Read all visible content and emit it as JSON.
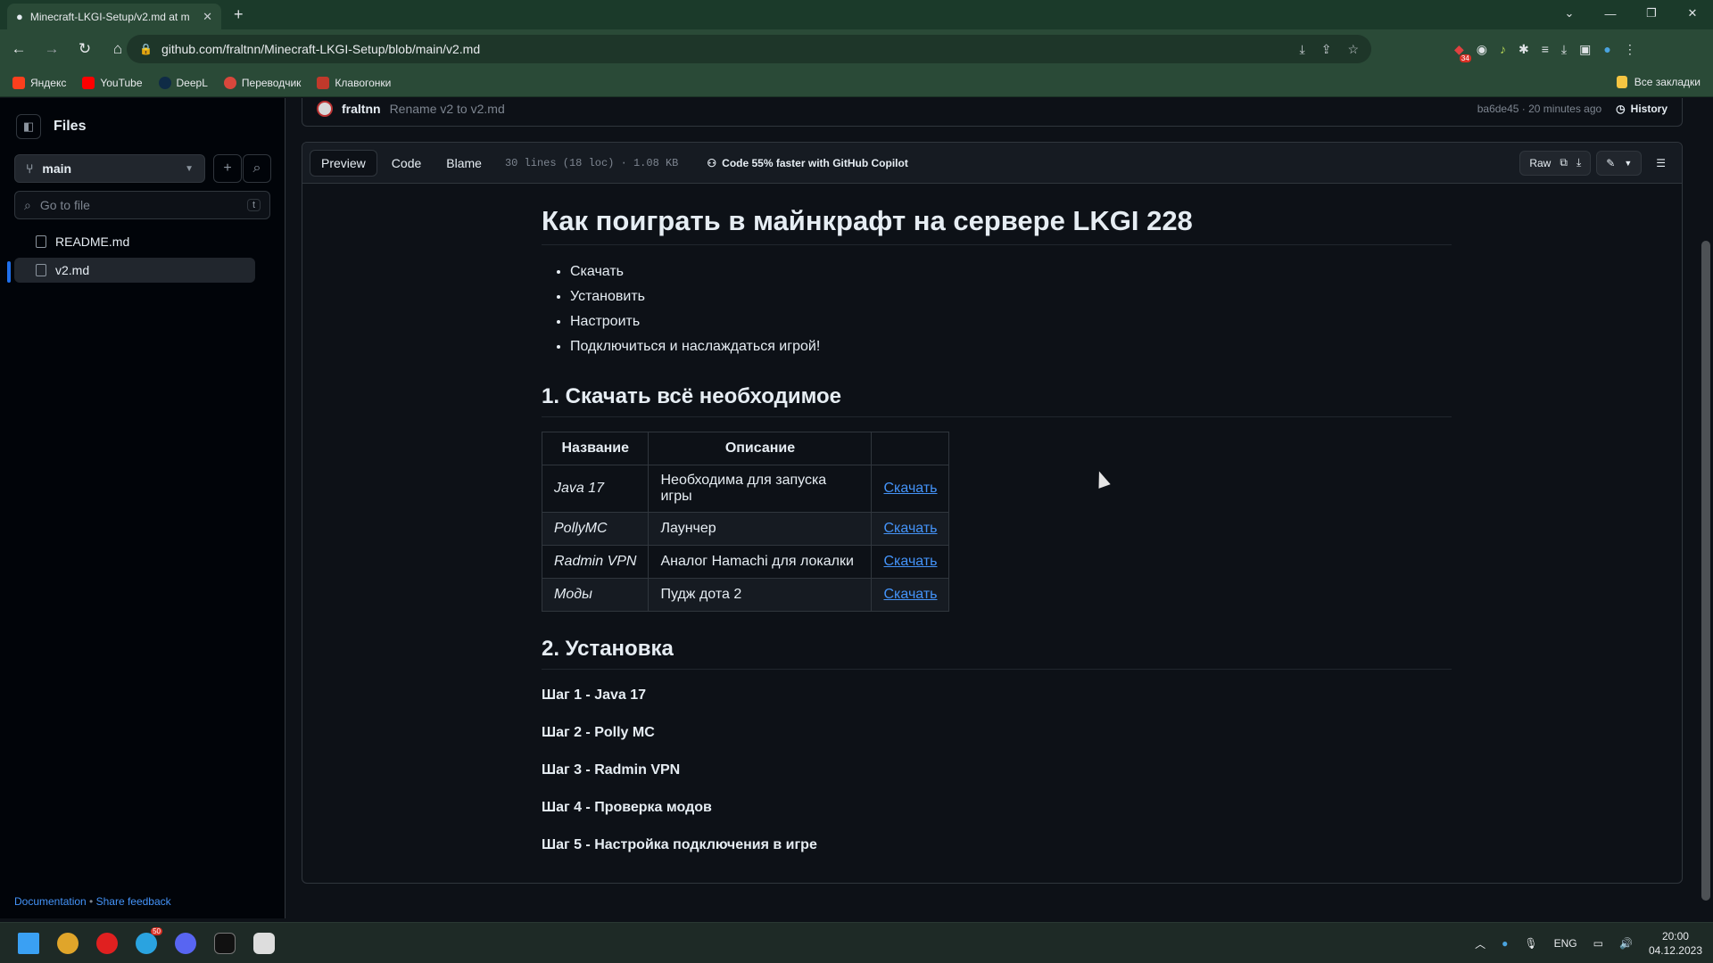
{
  "browser": {
    "tab_title": "Minecraft-LKGI-Setup/v2.md at m",
    "url": "github.com/fraltnn/Minecraft-LKGI-Setup/blob/main/v2.md",
    "extension_badge": "34",
    "bookmarks": [
      "Яндекс",
      "YouTube",
      "DeepL",
      "Переводчик",
      "Клавогонки"
    ],
    "all_bookmarks": "Все закладки"
  },
  "sidebar": {
    "title": "Files",
    "branch": "main",
    "search_placeholder": "Go to file",
    "search_shortcut": "t",
    "files": [
      "README.md",
      "v2.md"
    ],
    "footer_doc": "Documentation",
    "footer_sep": " • ",
    "footer_feedback": "Share feedback"
  },
  "commit": {
    "author": "fraltnn",
    "message": "Rename v2 to v2.md",
    "info": "ba6de45 · 20 minutes ago",
    "history": "History"
  },
  "file_header": {
    "tabs": [
      "Preview",
      "Code",
      "Blame"
    ],
    "meta": "30 lines (18 loc) · 1.08 KB",
    "copilot": "Code 55% faster with GitHub Copilot",
    "raw": "Raw"
  },
  "markdown": {
    "h1": "Как поиграть в майнкрафт на сервере LKGI 228",
    "list": [
      "Скачать",
      "Установить",
      "Настроить",
      "Подключиться и наслаждаться игрой!"
    ],
    "h2_download": "1. Скачать всё необходимое",
    "table_headers": [
      "Название",
      "Описание",
      ""
    ],
    "table_rows": [
      {
        "name": "Java 17",
        "desc": "Необходима для запуска игры",
        "link": "Скачать"
      },
      {
        "name": "PollyMC",
        "desc": "Лаунчер",
        "link": "Скачать"
      },
      {
        "name": "Radmin VPN",
        "desc": "Аналог Hamachi для локалки",
        "link": "Скачать"
      },
      {
        "name": "Моды",
        "desc": "Пудж дота 2",
        "link": "Скачать"
      }
    ],
    "h2_install": "2. Установка",
    "steps": [
      "Шаг 1 - Java 17",
      "Шаг 2 - Polly MC",
      "Шаг 3 - Radmin VPN",
      "Шаг 4 - Проверка модов",
      "Шаг 5 - Настройка подключения в игре"
    ]
  },
  "taskbar": {
    "lang": "ENG",
    "time": "20:00",
    "date": "04.12.2023",
    "telegram_badge": "50"
  }
}
